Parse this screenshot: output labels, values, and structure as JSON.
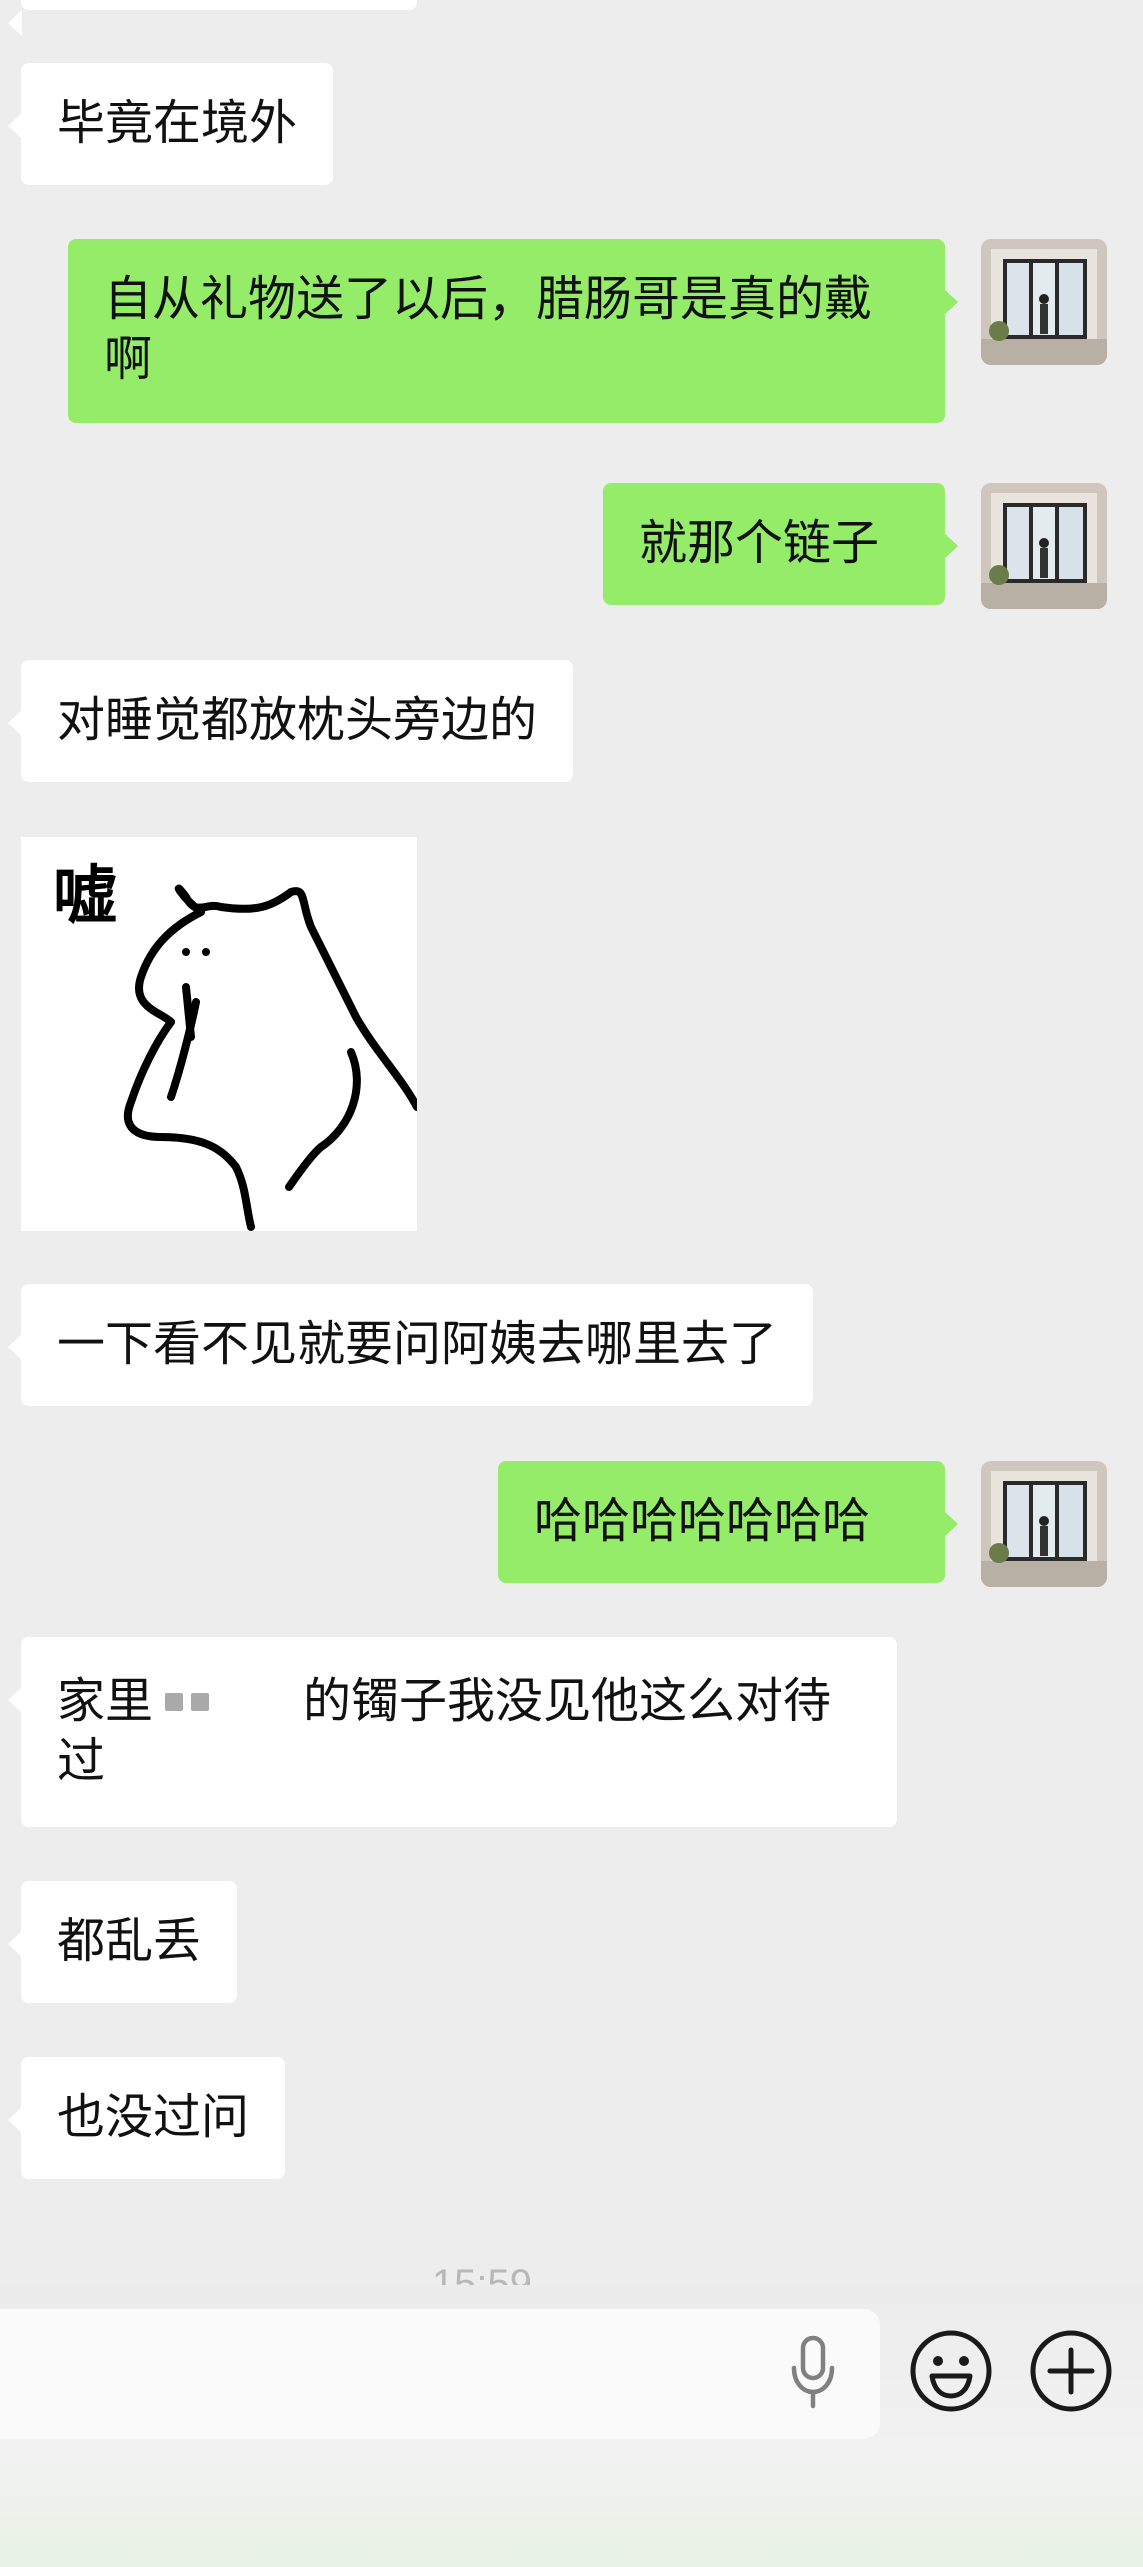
{
  "messages": [
    {
      "side": "in",
      "text": "毕竟在境外"
    },
    {
      "side": "out",
      "text": "自从礼物送了以后，腊肠哥是真的戴啊"
    },
    {
      "side": "out",
      "text": "就那个链子"
    },
    {
      "side": "in",
      "text": "对睡觉都放枕头旁边的"
    },
    {
      "side": "in",
      "sticker_text": "嘘"
    },
    {
      "side": "in",
      "text": "一下看不见就要问阿姨去哪里去了"
    },
    {
      "side": "out",
      "text": "哈哈哈哈哈哈哈"
    },
    {
      "side": "in",
      "text_part1": "家里",
      "text_part2": "的镯子我没见他这么对待过"
    },
    {
      "side": "in",
      "text": "都乱丢"
    },
    {
      "side": "in",
      "text": "也没过问"
    }
  ],
  "timestamp": "15:59",
  "input_bar": {
    "voice_icon": "microphone-icon",
    "emoji_icon": "emoji-icon",
    "more_icon": "plus-circle-icon"
  }
}
